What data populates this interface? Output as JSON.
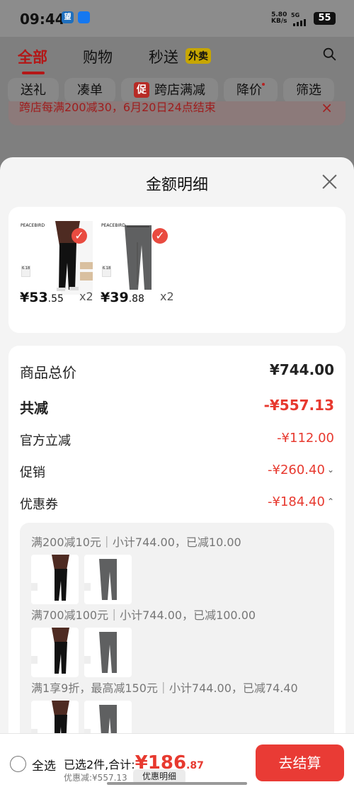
{
  "status": {
    "time": "09:44",
    "app1": "望",
    "app2": "",
    "speed": "5.80",
    "speed_unit": "KB/s",
    "network": "5G",
    "battery": "55"
  },
  "tabs": {
    "all": "全部",
    "shopping": "购物",
    "express": "秒送",
    "takeout": "外卖"
  },
  "filters": [
    "送礼",
    "凑单",
    "跨店满减",
    "降价",
    "筛选"
  ],
  "promo_icon": "促",
  "notice": "跨店每满200减30，6月20日24点结束",
  "sheet": {
    "title": "金额明细"
  },
  "products": [
    {
      "brand": "PEACEBIRD",
      "tag": "6.18",
      "price_main": "¥53",
      "price_decimal": ".55",
      "quantity": "x2"
    },
    {
      "brand": "PEACEBIRD",
      "tag": "6.18",
      "price_main": "¥39",
      "price_decimal": ".88",
      "quantity": "x2"
    }
  ],
  "amounts": {
    "total_label": "商品总价",
    "total_value": "¥744.00",
    "reduce_label": "共减",
    "reduce_value": "-¥557.13",
    "official_label": "官方立减",
    "official_value": "-¥112.00",
    "promotion_label": "促销",
    "promotion_value": "-¥260.40",
    "coupon_label": "优惠券",
    "coupon_value": "-¥184.40"
  },
  "coupon_lines": [
    "满200减10元｜小计744.00，已减10.00",
    "满700减100元｜小计744.00，已减100.00",
    "满1享9折，最高减150元｜小计744.00，已减74.40"
  ],
  "bottom": {
    "select_all": "全选",
    "selected_text": "已选2件,合计:",
    "total_main": "¥186",
    "total_decimal": ".87",
    "saved_text": "优惠减:¥557.13",
    "detail_button": "优惠明细",
    "checkout_button": "去结算"
  },
  "colors": {
    "accent": "#e93b35",
    "red_text": "#e7392f"
  }
}
